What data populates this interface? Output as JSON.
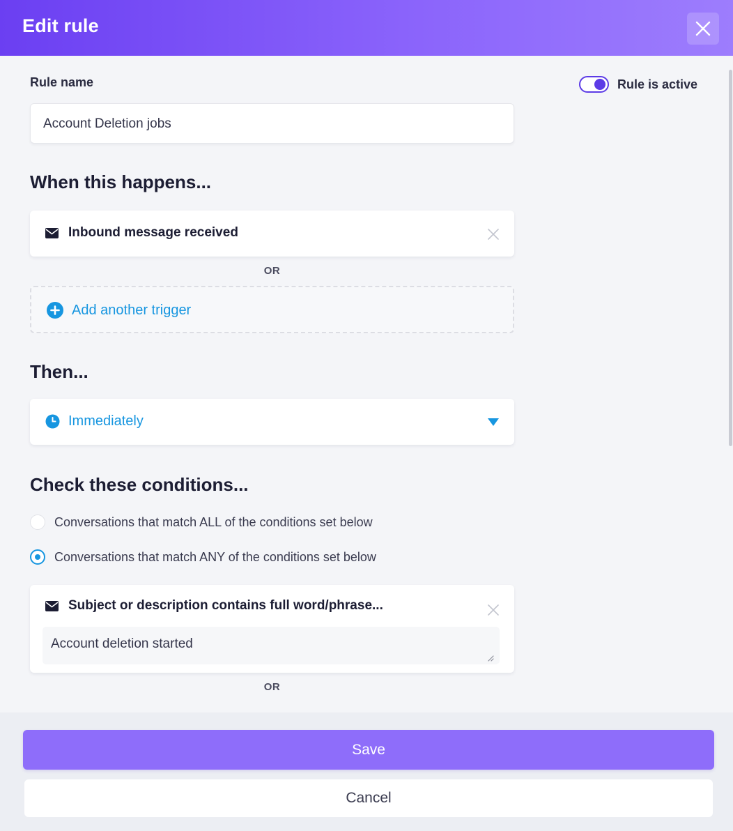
{
  "header": {
    "title": "Edit rule",
    "close_icon": "close-icon"
  },
  "rule_name": {
    "label": "Rule name",
    "value": "Account Deletion jobs"
  },
  "active_toggle": {
    "label": "Rule is active",
    "on": true
  },
  "when": {
    "title": "When this happens...",
    "trigger": {
      "icon": "envelope-icon",
      "label": "Inbound message received"
    },
    "or_label": "OR",
    "add_trigger": {
      "icon": "plus-circle-icon",
      "label": "Add another trigger"
    }
  },
  "then": {
    "title": "Then...",
    "timing": {
      "icon": "clock-icon",
      "value": "Immediately"
    }
  },
  "conditions": {
    "title": "Check these conditions...",
    "options": [
      {
        "label": "Conversations that match ALL of the conditions set below",
        "checked": false
      },
      {
        "label": "Conversations that match ANY of the conditions set below",
        "checked": true
      }
    ],
    "condition": {
      "icon": "envelope-icon",
      "label": "Subject or description contains full word/phrase...",
      "value": "Account deletion started"
    },
    "or_label": "OR"
  },
  "footer": {
    "save_label": "Save",
    "cancel_label": "Cancel"
  },
  "colors": {
    "accent_purple": "#6b3ff2",
    "save_button": "#8e6dfa",
    "link_blue": "#1796e0"
  }
}
